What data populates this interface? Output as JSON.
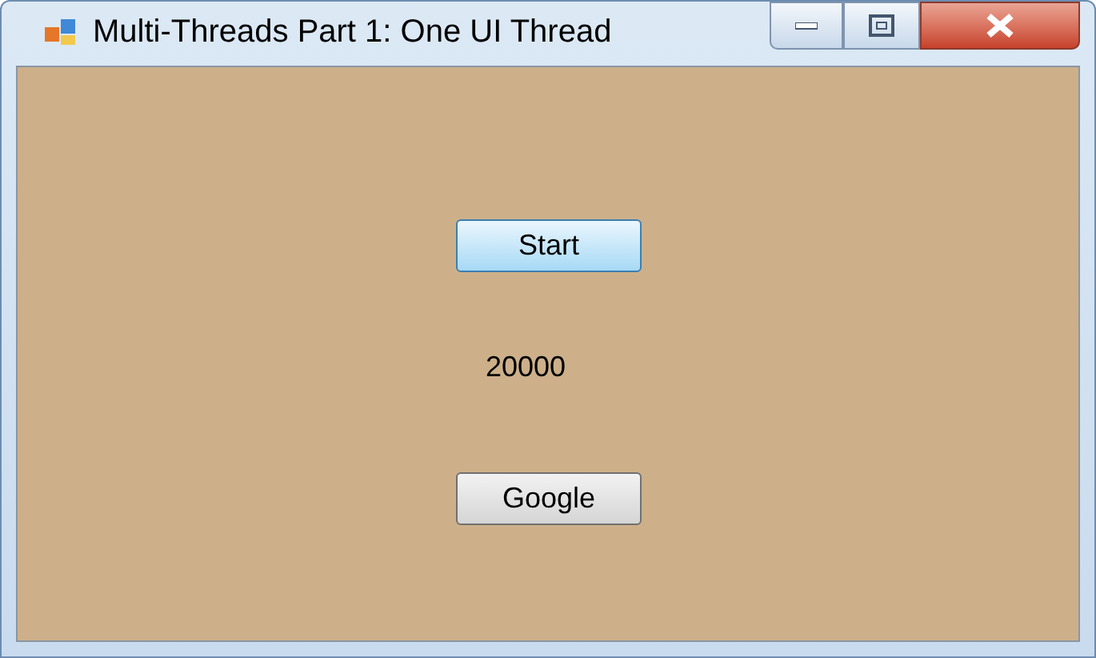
{
  "window": {
    "title": "Multi-Threads Part 1: One UI Thread"
  },
  "controls": [
    {
      "kind": "button",
      "label": "Start",
      "focused": true
    },
    {
      "kind": "label",
      "text": "20000"
    },
    {
      "kind": "button",
      "label": "Google",
      "focused": false
    }
  ]
}
